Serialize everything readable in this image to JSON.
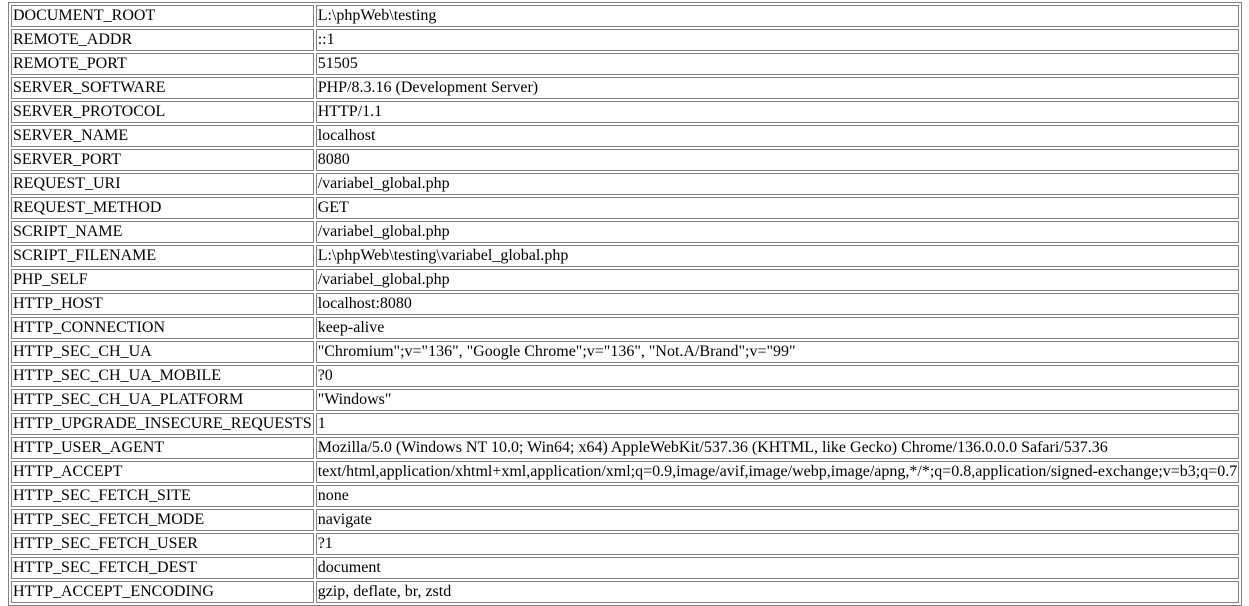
{
  "rows": [
    {
      "key": "DOCUMENT_ROOT",
      "value": "L:\\phpWeb\\testing"
    },
    {
      "key": "REMOTE_ADDR",
      "value": "::1"
    },
    {
      "key": "REMOTE_PORT",
      "value": "51505"
    },
    {
      "key": "SERVER_SOFTWARE",
      "value": "PHP/8.3.16 (Development Server)"
    },
    {
      "key": "SERVER_PROTOCOL",
      "value": "HTTP/1.1"
    },
    {
      "key": "SERVER_NAME",
      "value": "localhost"
    },
    {
      "key": "SERVER_PORT",
      "value": "8080"
    },
    {
      "key": "REQUEST_URI",
      "value": "/variabel_global.php"
    },
    {
      "key": "REQUEST_METHOD",
      "value": "GET"
    },
    {
      "key": "SCRIPT_NAME",
      "value": "/variabel_global.php"
    },
    {
      "key": "SCRIPT_FILENAME",
      "value": "L:\\phpWeb\\testing\\variabel_global.php"
    },
    {
      "key": "PHP_SELF",
      "value": "/variabel_global.php"
    },
    {
      "key": "HTTP_HOST",
      "value": "localhost:8080"
    },
    {
      "key": "HTTP_CONNECTION",
      "value": "keep-alive"
    },
    {
      "key": "HTTP_SEC_CH_UA",
      "value": "\"Chromium\";v=\"136\", \"Google Chrome\";v=\"136\", \"Not.A/Brand\";v=\"99\""
    },
    {
      "key": "HTTP_SEC_CH_UA_MOBILE",
      "value": "?0"
    },
    {
      "key": "HTTP_SEC_CH_UA_PLATFORM",
      "value": "\"Windows\""
    },
    {
      "key": "HTTP_UPGRADE_INSECURE_REQUESTS",
      "value": "1"
    },
    {
      "key": "HTTP_USER_AGENT",
      "value": "Mozilla/5.0 (Windows NT 10.0; Win64; x64) AppleWebKit/537.36 (KHTML, like Gecko) Chrome/136.0.0.0 Safari/537.36"
    },
    {
      "key": "HTTP_ACCEPT",
      "value": "text/html,application/xhtml+xml,application/xml;q=0.9,image/avif,image/webp,image/apng,*/*;q=0.8,application/signed-exchange;v=b3;q=0.7"
    },
    {
      "key": "HTTP_SEC_FETCH_SITE",
      "value": "none"
    },
    {
      "key": "HTTP_SEC_FETCH_MODE",
      "value": "navigate"
    },
    {
      "key": "HTTP_SEC_FETCH_USER",
      "value": "?1"
    },
    {
      "key": "HTTP_SEC_FETCH_DEST",
      "value": "document"
    },
    {
      "key": "HTTP_ACCEPT_ENCODING",
      "value": "gzip, deflate, br, zstd"
    }
  ]
}
